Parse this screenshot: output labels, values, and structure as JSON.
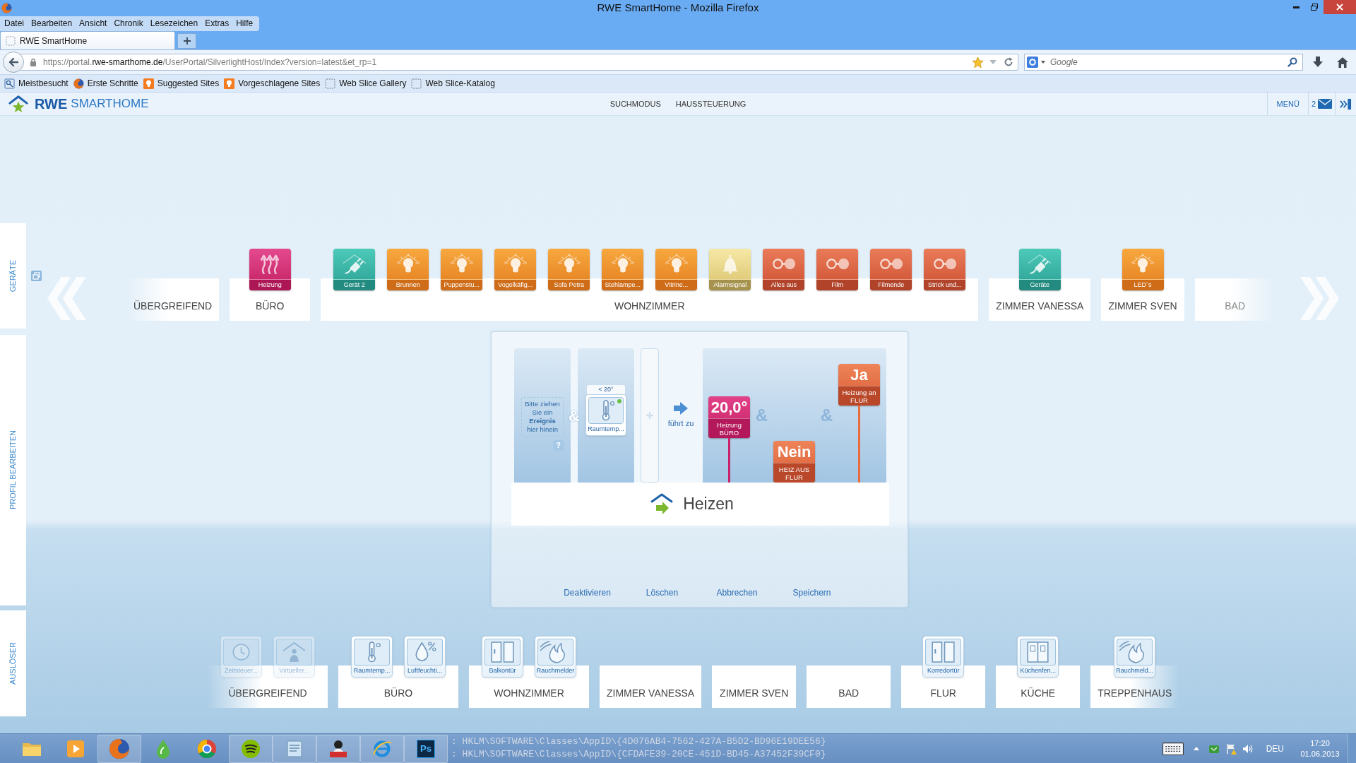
{
  "window": {
    "title": "RWE SmartHome - Mozilla Firefox"
  },
  "menu_bar": [
    "Datei",
    "Bearbeiten",
    "Ansicht",
    "Chronik",
    "Lesezeichen",
    "Extras",
    "Hilfe"
  ],
  "tabs": [
    {
      "label": "RWE SmartHome",
      "selected": true
    }
  ],
  "address_bar": {
    "url": "https://portal.**rwe-smarthome.de**/UserPortal/SilverlightHost/Index?version=latest&et_rp=1"
  },
  "search_bar": {
    "placeholder": "Google"
  },
  "bookmarks": [
    {
      "label": "Meistbesucht",
      "kind": "most_visited"
    },
    {
      "label": "Erste Schritte",
      "kind": "firefox"
    },
    {
      "label": "Suggested Sites",
      "kind": "suggested"
    },
    {
      "label": "Vorgeschlagene Sites",
      "kind": "suggested"
    },
    {
      "label": "Web Slice Gallery",
      "kind": "webslice"
    },
    {
      "label": "Web Slice-Katalog",
      "kind": "webslice"
    }
  ],
  "app_header": {
    "logo": {
      "brand": "RWE",
      "product": "SMARTHOME"
    },
    "nav": [
      "SUCHMODUS",
      "HAUSSTEUERUNG"
    ],
    "menu": "MENÜ",
    "message_count": "2"
  },
  "side_tabs": [
    "GERÄTE",
    "PROFIL BEARBEITEN",
    "AUSLÖSER"
  ],
  "devices": {
    "rooms": [
      {
        "name": "ÜBERGREIFEND"
      },
      {
        "name": "BÜRO",
        "devices": [
          {
            "label": "Heizung",
            "kind": "heating"
          }
        ]
      },
      {
        "name": "WOHNZIMMER",
        "devices": [
          {
            "label": "Gerät 2",
            "kind": "plug"
          },
          {
            "label": "Brunnen",
            "kind": "bulb"
          },
          {
            "label": "Puppenstu...",
            "kind": "bulb"
          },
          {
            "label": "Vogelkäfig...",
            "kind": "bulb"
          },
          {
            "label": "Sofa Petra",
            "kind": "bulb"
          },
          {
            "label": "Stehlampe...",
            "kind": "bulb"
          },
          {
            "label": "Vitrine...",
            "kind": "bulb"
          },
          {
            "label": "Alarmsignal",
            "kind": "bell"
          },
          {
            "label": "Alles aus",
            "kind": "scene"
          },
          {
            "label": "Film",
            "kind": "scene"
          },
          {
            "label": "Filmende",
            "kind": "scene"
          },
          {
            "label": "Strick und...",
            "kind": "scene"
          }
        ]
      },
      {
        "name": "ZIMMER VANESSA",
        "devices": [
          {
            "label": "Geräte",
            "kind": "plug"
          }
        ]
      },
      {
        "name": "ZIMMER SVEN",
        "devices": [
          {
            "label": "LED´s",
            "kind": "bulb"
          }
        ]
      },
      {
        "name": "BAD"
      }
    ]
  },
  "rule": {
    "trigger_columns": [
      {
        "kind": "drop_zone",
        "text": "Bitte ziehen Sie ein **Ereignis** hier hinein",
        "help": "?"
      },
      {
        "kind": "condition",
        "threshold": "< 20°",
        "label": "Raumtemp..."
      }
    ],
    "trigger_joiner": "&",
    "leads_to": "führt zu",
    "actions": [
      {
        "value": "20,0°",
        "label": "Heizung BÜRO",
        "kind": "heating"
      },
      {
        "value": "Nein",
        "label": "HEIZ AUS FLUR",
        "kind": "scene"
      },
      {
        "value": "Ja",
        "label": "Heizung an FLUR",
        "kind": "scene"
      }
    ],
    "action_joiners": [
      "&",
      "&"
    ],
    "name": "Heizen"
  },
  "buttons": [
    "Deaktivieren",
    "Löschen",
    "Abbrechen",
    "Speichern"
  ],
  "triggers": {
    "rooms": [
      {
        "name": "ÜBERGREIFEND",
        "sensors": [
          {
            "label": "Zeitsteuer...",
            "kind": "clock",
            "disabled": true
          },
          {
            "label": "Virtueller...",
            "kind": "person",
            "disabled": true
          }
        ]
      },
      {
        "name": "BÜRO",
        "sensors": [
          {
            "label": "Raumtemp...",
            "kind": "thermometer",
            "disabled": false
          },
          {
            "label": "Luftfeuchti...",
            "kind": "humidity",
            "disabled": false
          }
        ]
      },
      {
        "name": "WOHNZIMMER",
        "sensors": [
          {
            "label": "Balkontür",
            "kind": "door",
            "disabled": false
          },
          {
            "label": "Rauchmelder",
            "kind": "smoke",
            "disabled": false
          }
        ]
      },
      {
        "name": "ZIMMER VANESSA"
      },
      {
        "name": "ZIMMER SVEN"
      },
      {
        "name": "BAD"
      },
      {
        "name": "FLUR",
        "sensors": [
          {
            "label": "Korredortür",
            "kind": "door",
            "disabled": false
          }
        ]
      },
      {
        "name": "KÜCHE",
        "sensors": [
          {
            "label": "Küchenfen...",
            "kind": "window",
            "disabled": false
          }
        ]
      },
      {
        "name": "TREPPENHAUS",
        "sensors": [
          {
            "label": "Rauchmeld...",
            "kind": "smoke",
            "disabled": false
          }
        ]
      }
    ]
  },
  "taskbar": {
    "apps": [
      {
        "kind": "folder",
        "running": false
      },
      {
        "kind": "media",
        "running": false
      },
      {
        "kind": "firefox",
        "running": true
      },
      {
        "kind": "drop",
        "running": false
      },
      {
        "kind": "chrome",
        "running": false
      },
      {
        "kind": "spotify",
        "running": true
      },
      {
        "kind": "notes",
        "running": true
      },
      {
        "kind": "figure",
        "running": true
      },
      {
        "kind": "ie",
        "running": true
      },
      {
        "kind": "photoshop",
        "running": true,
        "text": "Ps"
      }
    ],
    "console_lines": [
      ": HKLM\\SOFTWARE\\Classes\\AppID\\{4D076AB4-7562-427A-B5D2-BD96E19DEE56}",
      ": HKLM\\SOFTWARE\\Classes\\AppID\\{CFDAFE39-20CE-451D-BD45-A37452F39CF0}"
    ],
    "language": "DEU",
    "time": "17:20",
    "date": "01.06.2013"
  }
}
